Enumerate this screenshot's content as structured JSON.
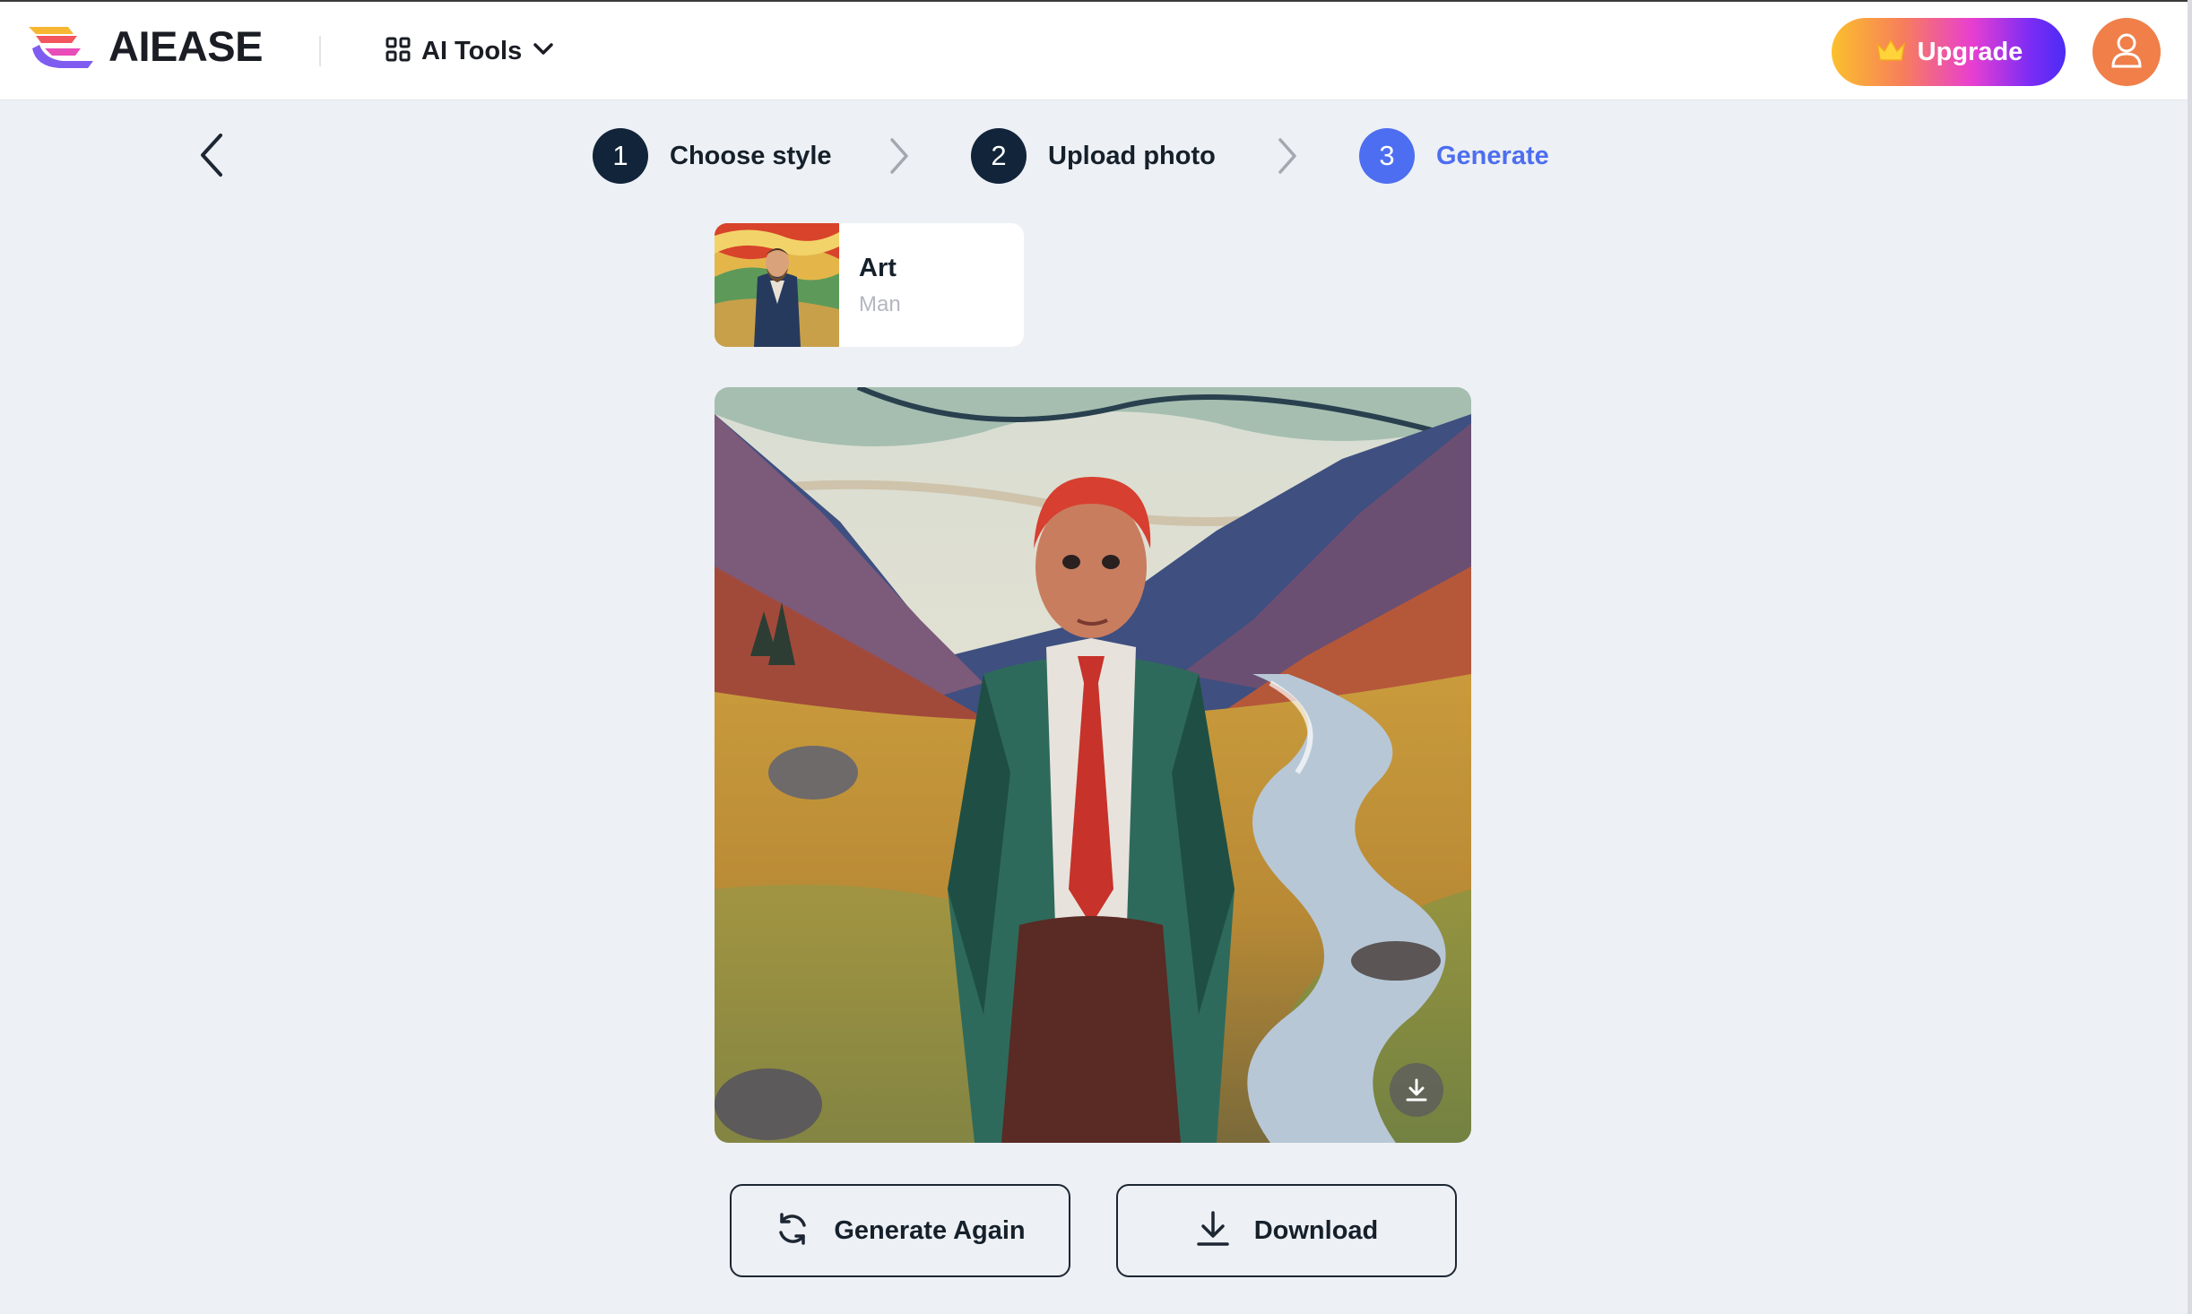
{
  "app": {
    "brand": "AIEASE",
    "tools_menu": {
      "label": "AI Tools",
      "icon": "grid-icon",
      "caret_icon": "chevron-down-icon"
    },
    "upgrade": {
      "label": "Upgrade",
      "icon": "crown-icon"
    },
    "account": {
      "icon": "user-icon"
    }
  },
  "colors": {
    "accent": "#4d6ef0",
    "step_dark": "#12243a",
    "avatar": "#f07f4a",
    "page_bg": "#edf0f4"
  },
  "steps": [
    {
      "number": "1",
      "label": "Choose style",
      "state": "done"
    },
    {
      "number": "2",
      "label": "Upload photo",
      "state": "done"
    },
    {
      "number": "3",
      "label": "Generate",
      "state": "active"
    }
  ],
  "selected_style": {
    "title": "Art",
    "subtitle": "Man"
  },
  "actions": {
    "generate_again": {
      "label": "Generate Again",
      "icon": "refresh-icon"
    },
    "download": {
      "label": "Download",
      "icon": "download-icon"
    }
  }
}
